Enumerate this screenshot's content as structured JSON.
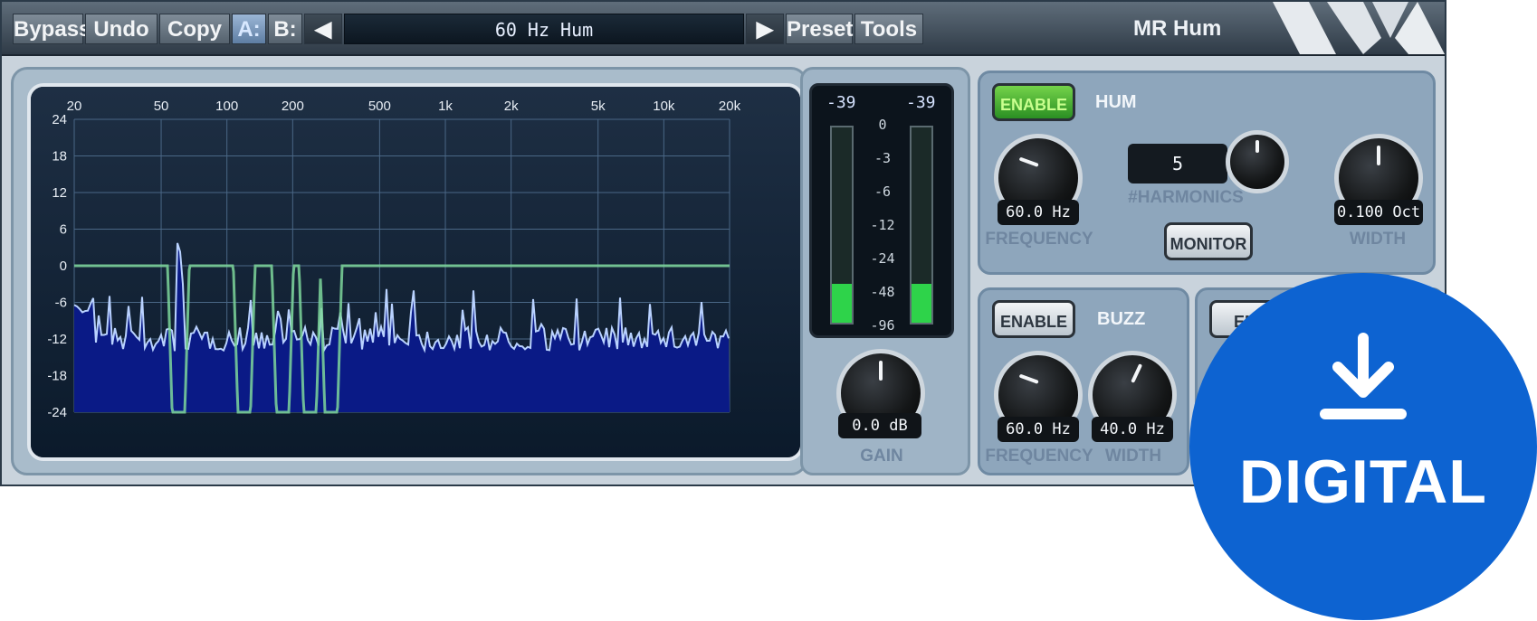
{
  "toolbar": {
    "bypass": "Bypass",
    "undo": "Undo",
    "copy": "Copy",
    "ab": "A:",
    "b": "B:",
    "prev_arrow": "◀",
    "preset_name": "60 Hz Hum",
    "next_arrow": "▶",
    "preset": "Preset",
    "tools": "Tools"
  },
  "title": "MR Hum",
  "analyzer": {
    "freq_ticks": [
      "20",
      "50",
      "100",
      "200",
      "500",
      "1k",
      "2k",
      "5k",
      "10k",
      "20k"
    ],
    "db_ticks": [
      "24",
      "18",
      "12",
      "6",
      "0",
      "-6",
      "-12",
      "-18",
      "-24"
    ]
  },
  "meters": {
    "peak_left": "-39",
    "peak_right": "-39",
    "scale": [
      "0",
      "-3",
      "-6",
      "-12",
      "-24",
      "-48",
      "-96"
    ],
    "level_left": 0.2,
    "level_right": 0.2,
    "fill_color": "#2ed34a"
  },
  "gain": {
    "value": "0.0 dB",
    "label": "GAIN"
  },
  "hum": {
    "enable_label": "ENABLE",
    "enabled": true,
    "title": "HUM",
    "frequency_value": "60.0 Hz",
    "frequency_label": "FREQUENCY",
    "harmonics_value": "5",
    "harmonics_label": "#HARMONICS",
    "monitor_label": "MONITOR",
    "width_value": "0.100 Oct",
    "width_label": "WIDTH"
  },
  "buzz": {
    "enable_label": "ENABLE",
    "enabled": false,
    "title": "BUZZ",
    "frequency_value": "60.0 Hz",
    "frequency_label": "FREQUENCY",
    "width_value": "40.0 Hz",
    "width_label": "WIDTH"
  },
  "third": {
    "enable_label": "ENA"
  },
  "badge": {
    "text": "DIGITAL",
    "icon": "download-icon",
    "color": "#0d63d1"
  }
}
